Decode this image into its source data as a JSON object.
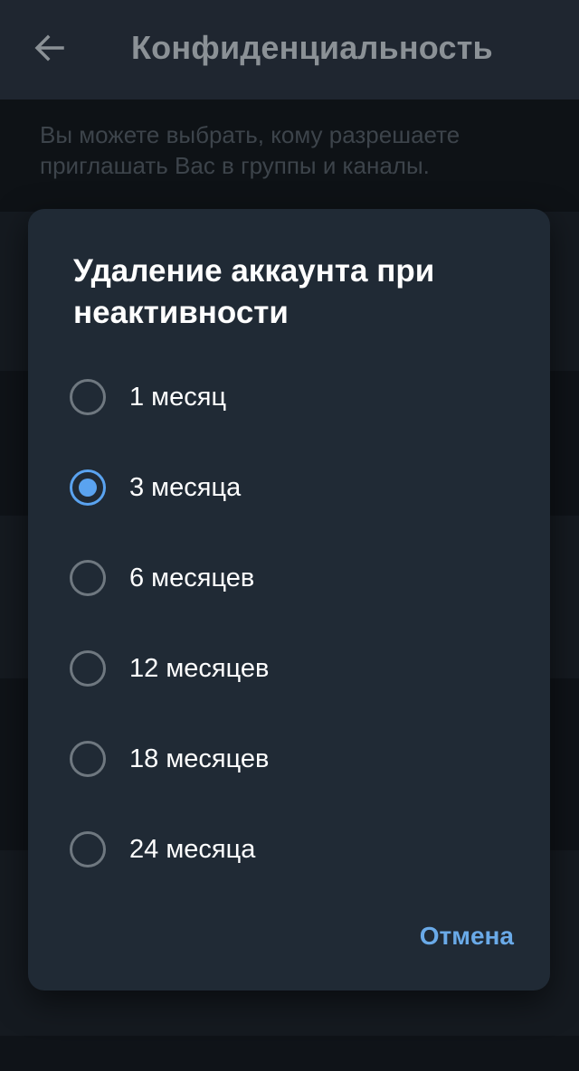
{
  "header": {
    "back_icon": "arrow-left-icon",
    "title": "Конфиденциальность"
  },
  "background": {
    "help_text": "Вы можете выбрать, кому разрешаете приглашать Вас в группы и каналы."
  },
  "dialog": {
    "title": "Удаление аккаунта при неактивности",
    "options": [
      {
        "label": "1 месяц",
        "selected": false
      },
      {
        "label": "3 месяца",
        "selected": true
      },
      {
        "label": "6 месяцев",
        "selected": false
      },
      {
        "label": "12 месяцев",
        "selected": false
      },
      {
        "label": "18 месяцев",
        "selected": false
      },
      {
        "label": "24 месяца",
        "selected": false
      }
    ],
    "cancel_label": "Отмена"
  },
  "colors": {
    "accent": "#5aa3f0",
    "dialog_background": "#202a35",
    "app_bar": "#1f2630"
  }
}
